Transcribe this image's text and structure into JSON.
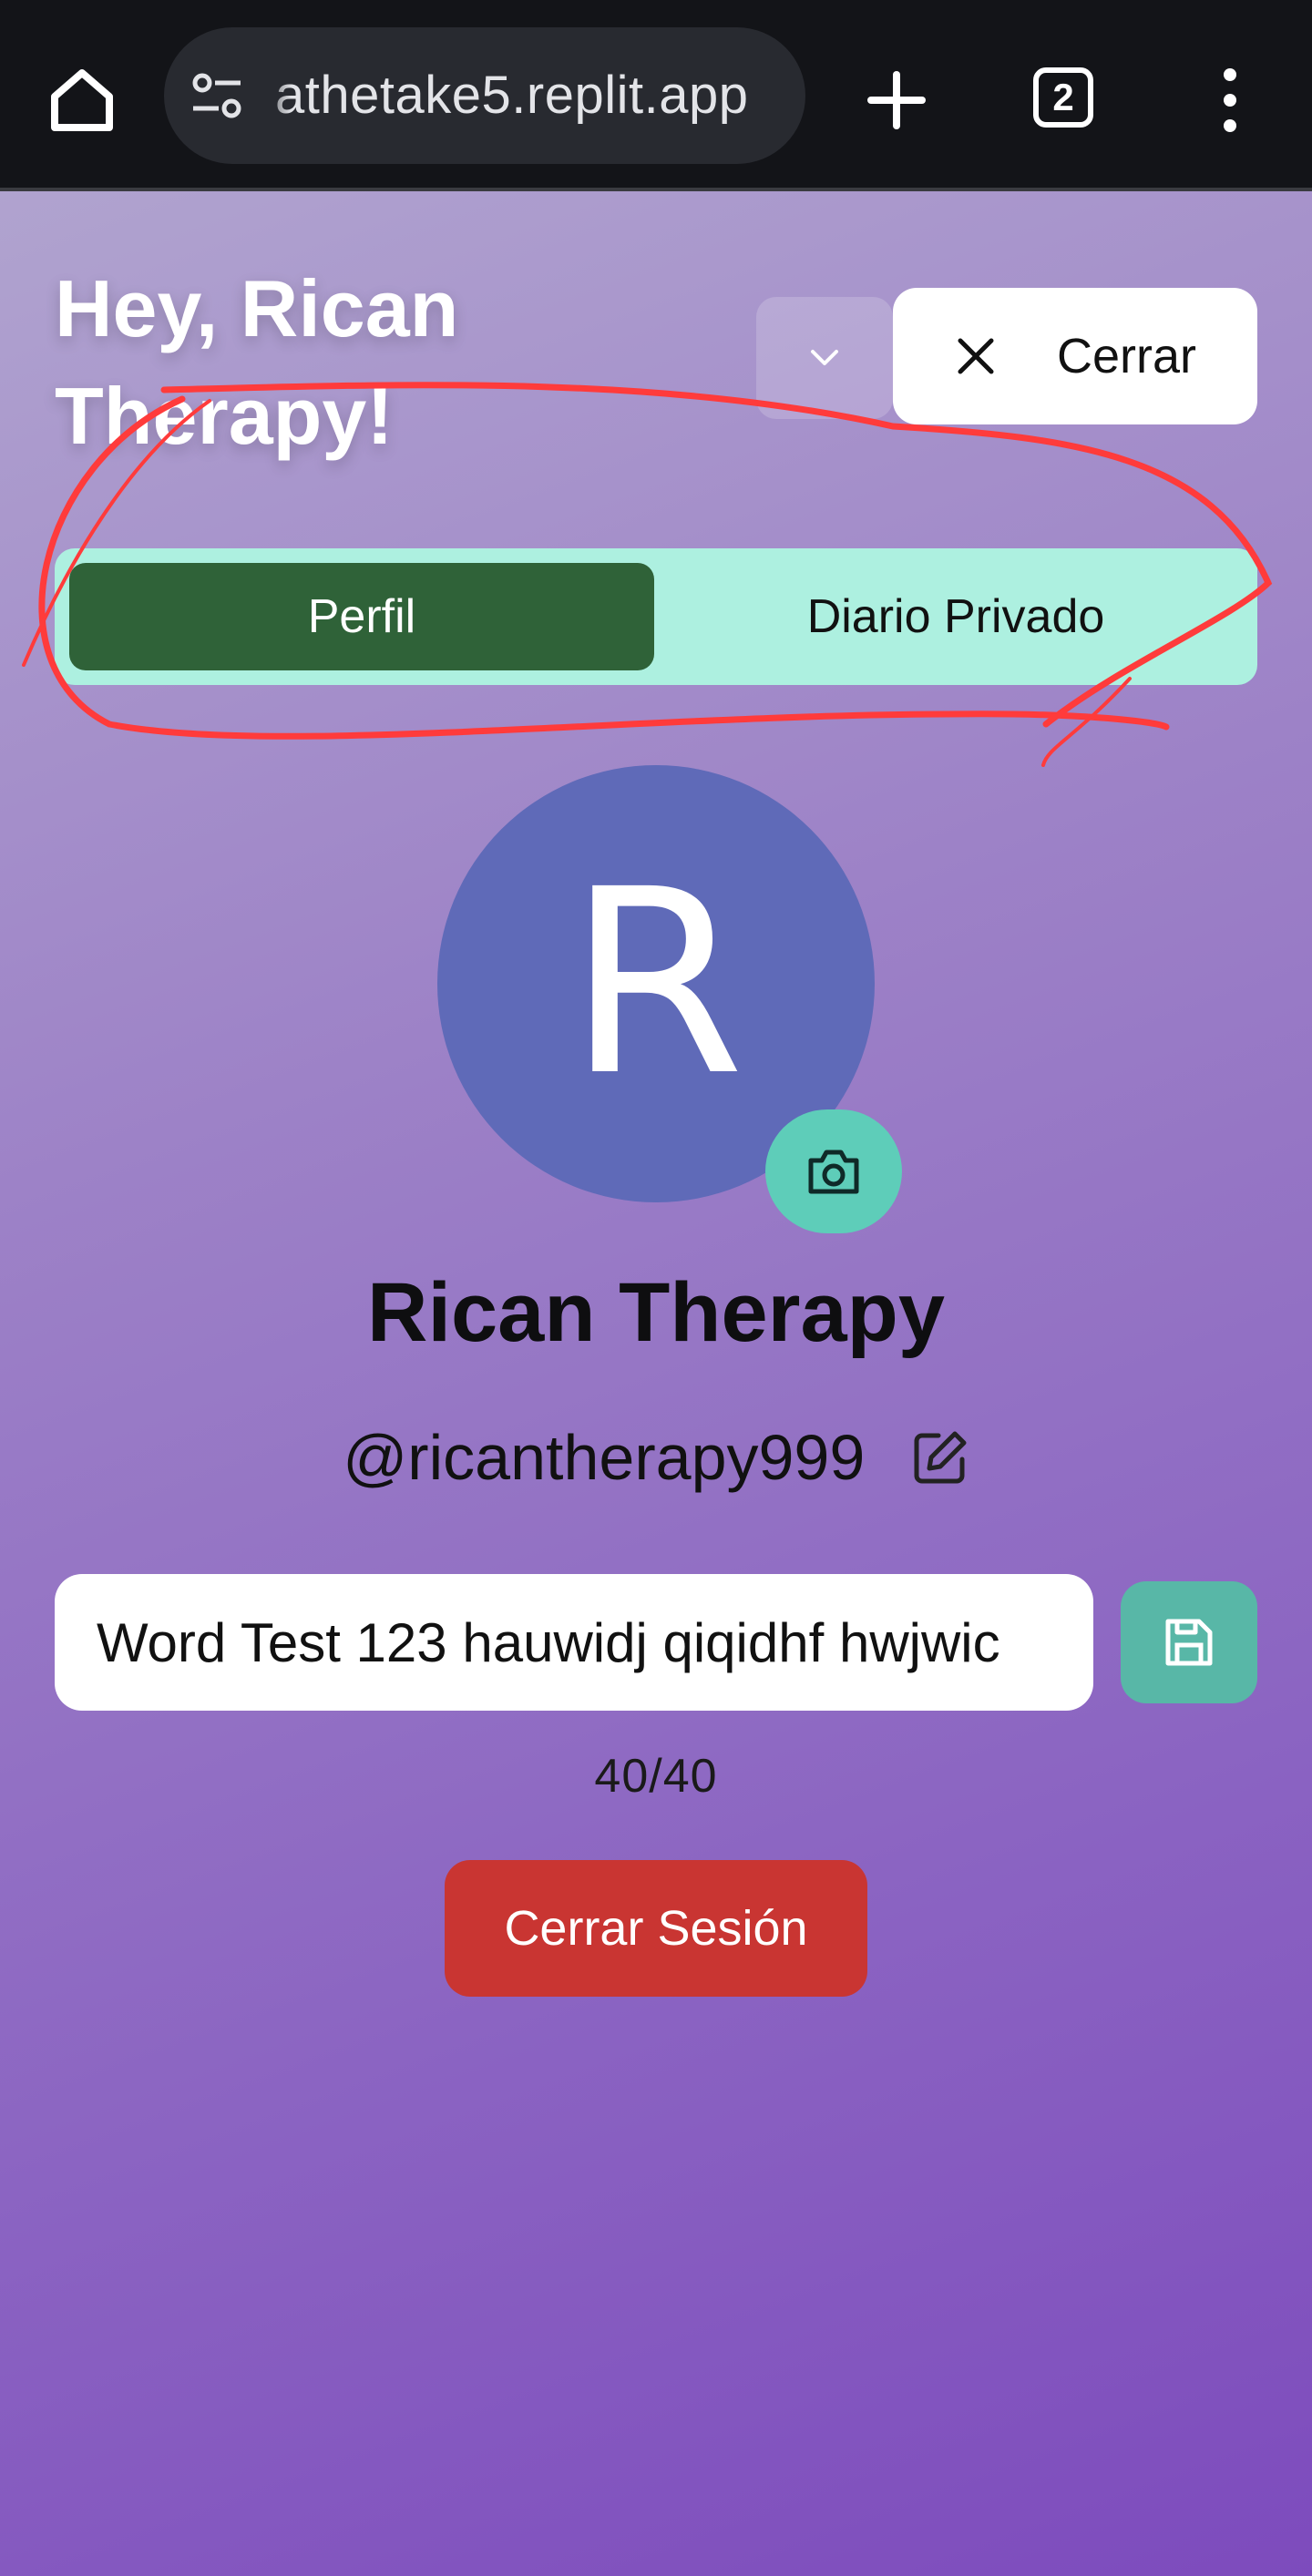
{
  "browser": {
    "url": "athetake5.replit.app",
    "tab_count": "2"
  },
  "header": {
    "greeting_line1": "Hey, Rican",
    "greeting_line2": "Therapy!",
    "close_label": "Cerrar"
  },
  "tabs": [
    {
      "label": "Perfil",
      "active": true
    },
    {
      "label": "Diario Privado",
      "active": false
    }
  ],
  "profile": {
    "avatar_initial": "R",
    "display_name": "Rican Therapy",
    "username": "@ricantherapy999",
    "status_value": "Word Test 123 hauwidj qiqidhf hwjwic",
    "char_count": "40/40"
  },
  "actions": {
    "logout_label": "Cerrar Sesión"
  },
  "colors": {
    "tab_active": "#2f6238",
    "tab_bar": "#adf0e0",
    "avatar_bg": "#5f6ab8",
    "camera_button": "#5ecdb9",
    "save_button": "#58b7a7",
    "logout_button": "#c93532",
    "annotation": "#ff3b3b"
  }
}
